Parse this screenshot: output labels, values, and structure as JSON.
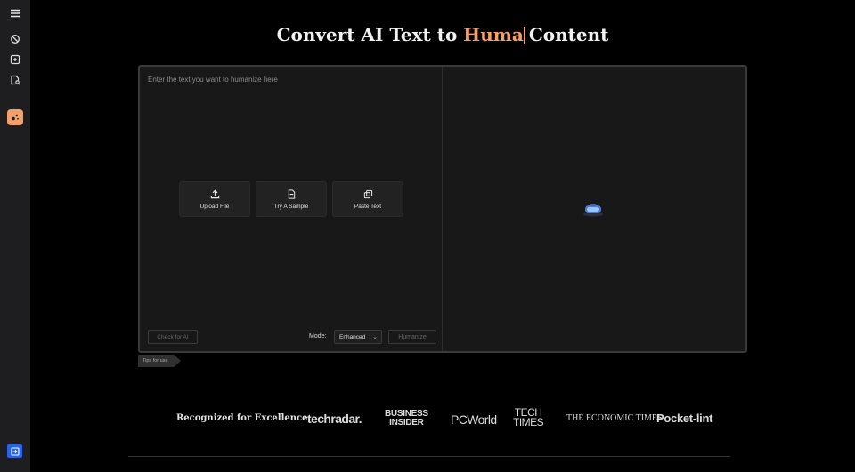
{
  "sidebar": {
    "items": [
      {
        "icon": "menu-icon"
      },
      {
        "icon": "ai-detector-icon"
      },
      {
        "icon": "add-icon"
      },
      {
        "icon": "file-search-icon"
      },
      {
        "icon": "humanizer-icon",
        "active": true
      },
      {
        "icon": "login-icon"
      }
    ]
  },
  "header": {
    "title_prefix": "Convert AI Text to",
    "title_highlight": "Huma",
    "title_suffix": "Content"
  },
  "editor": {
    "placeholder": "Enter the text you want to humanize here",
    "actions": [
      {
        "label": "Upload File",
        "icon": "upload-icon"
      },
      {
        "label": "Try A Sample",
        "icon": "document-icon"
      },
      {
        "label": "Paste Text",
        "icon": "copy-icon"
      }
    ],
    "check_button": "Check for AI",
    "mode_label": "Mode:",
    "mode_value": "Enhanced",
    "humanize_button": "Humanize",
    "output_icon": "robot-icon"
  },
  "tips": "Tips for use",
  "recognized": {
    "label": "Recognized for Excellence:",
    "logos": [
      {
        "name": "techradar",
        "line1": "techradar."
      },
      {
        "name": "business-insider",
        "line1": "BUSINESS",
        "line2": "INSIDER"
      },
      {
        "name": "pcworld",
        "line1": "PCWorld"
      },
      {
        "name": "tech-times",
        "line1": "TECH",
        "line2": "TIMES"
      },
      {
        "name": "economic-times",
        "line1": "THE ECONOMIC TIMES"
      },
      {
        "name": "pocket-lint",
        "line1": "Pocket-lint"
      }
    ]
  },
  "colors": {
    "accent": "#f4a06b",
    "background": "#000000",
    "sidebar": "#1e1e20",
    "editor": "#181818",
    "login": "#2563eb"
  }
}
